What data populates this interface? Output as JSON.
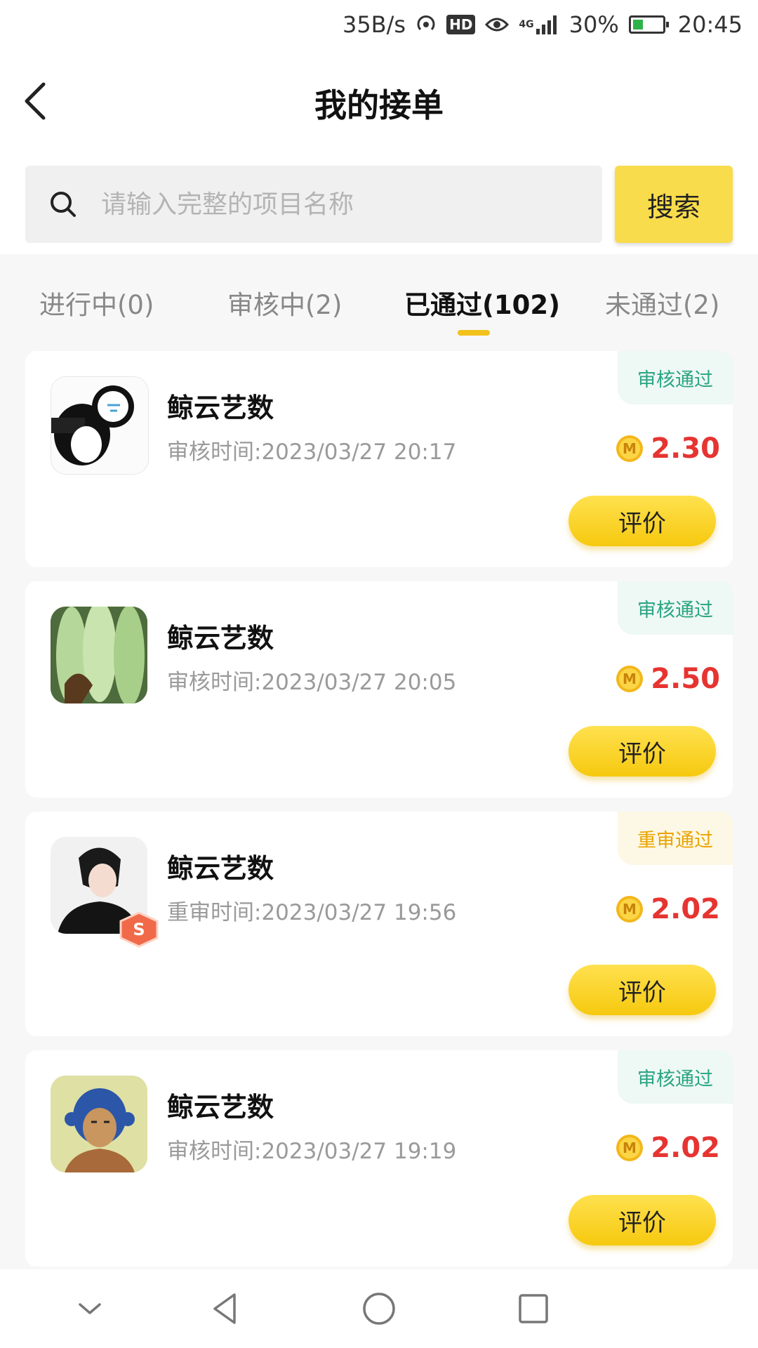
{
  "status_bar": {
    "net_speed": "35B/s",
    "hd_label": "HD",
    "network": "4G",
    "battery": "30%",
    "time": "20:45"
  },
  "header": {
    "title": "我的接单"
  },
  "search": {
    "placeholder": "请输入完整的项目名称",
    "button_label": "搜索"
  },
  "tabs": [
    {
      "label": "进行中(0)"
    },
    {
      "label": "审核中(2)"
    },
    {
      "label": "已通过(102)",
      "active": true
    },
    {
      "label": "未通过(2)"
    }
  ],
  "orders": [
    {
      "title": "鲸云艺数",
      "time": "审核时间:2023/03/27 20:17",
      "status": "审核通过",
      "amount": "2.30",
      "button": "评价"
    },
    {
      "title": "鲸云艺数",
      "time": "审核时间:2023/03/27 20:05",
      "status": "审核通过",
      "amount": "2.50",
      "button": "评价"
    },
    {
      "title": "鲸云艺数",
      "time": "重审时间:2023/03/27 19:56",
      "status": "重审通过",
      "amount": "2.02",
      "button": "评价"
    },
    {
      "title": "鲸云艺数",
      "time": "审核时间:2023/03/27 19:19",
      "status": "审核通过",
      "amount": "2.02",
      "button": "评价"
    }
  ],
  "colors": {
    "accent": "#f9dc4c",
    "amount": "#e63431",
    "status_pass": "#2aa582",
    "status_recheck": "#e9a400"
  }
}
